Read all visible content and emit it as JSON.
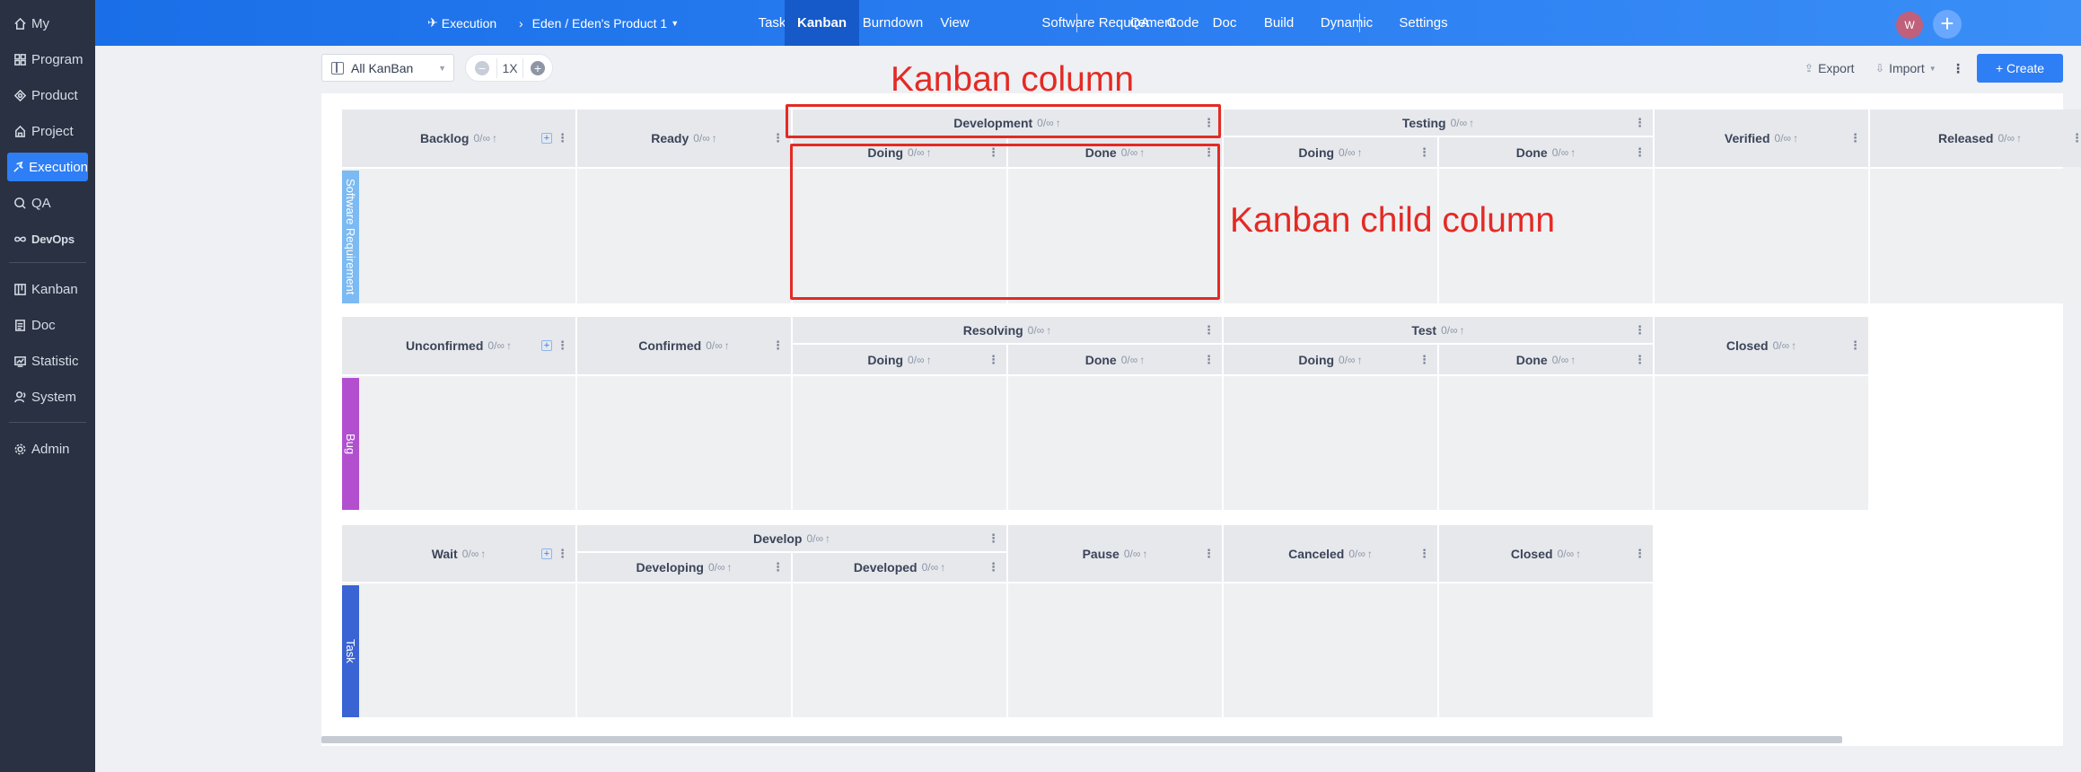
{
  "sidebar": {
    "items": [
      {
        "label": "My",
        "icon": "home-icon"
      },
      {
        "label": "Program",
        "icon": "grid-icon"
      },
      {
        "label": "Product",
        "icon": "product-icon"
      },
      {
        "label": "Project",
        "icon": "project-icon"
      },
      {
        "label": "Execution",
        "icon": "run-icon",
        "active": true
      },
      {
        "label": "QA",
        "icon": "qa-icon"
      },
      {
        "label": "DevOps",
        "icon": "infinity-icon"
      },
      {
        "label": "Kanban",
        "icon": "kanban-icon"
      },
      {
        "label": "Doc",
        "icon": "doc-icon"
      },
      {
        "label": "Statistic",
        "icon": "statistic-icon"
      },
      {
        "label": "System",
        "icon": "users-icon"
      },
      {
        "label": "Admin",
        "icon": "gear-icon"
      }
    ]
  },
  "topbar": {
    "module": "Execution",
    "breadcrumb": "Eden / Eden's Product 1",
    "nav": [
      "Task",
      "Kanban",
      "Burndown",
      "View",
      "Software Requirement",
      "QA",
      "Code",
      "Doc",
      "Build",
      "Dynamic",
      "Settings"
    ],
    "active_nav": "Kanban",
    "avatar": "W",
    "plus": "+"
  },
  "toolbar": {
    "kanban_select": "All KanBan",
    "zoom": "1X",
    "zoom_minus": "−",
    "zoom_plus": "+",
    "export": "Export",
    "import": "Import",
    "more": "⋮",
    "create": "+ Create"
  },
  "board": {
    "wip": "0/∞",
    "more": "⋮",
    "groups": [
      {
        "lane": "Software Requirement",
        "color": "#7bbaf2",
        "columns": [
          {
            "name": "Backlog"
          },
          {
            "name": "Ready"
          },
          {
            "name": "Development",
            "children": [
              "Doing",
              "Done"
            ]
          },
          {
            "name": "Testing",
            "children": [
              "Doing",
              "Done"
            ]
          },
          {
            "name": "Verified"
          },
          {
            "name": "Released"
          }
        ]
      },
      {
        "lane": "Bug",
        "color": "#b24fcf",
        "columns": [
          {
            "name": "Unconfirmed"
          },
          {
            "name": "Confirmed"
          },
          {
            "name": "Resolving",
            "children": [
              "Doing",
              "Done"
            ]
          },
          {
            "name": "Test",
            "children": [
              "Doing",
              "Done"
            ]
          },
          {
            "name": "Closed"
          }
        ]
      },
      {
        "lane": "Task",
        "color": "#3a63d4",
        "columns": [
          {
            "name": "Wait"
          },
          {
            "name": "Develop",
            "children": [
              "Developing",
              "Developed"
            ]
          },
          {
            "name": "Pause"
          },
          {
            "name": "Canceled"
          },
          {
            "name": "Closed"
          }
        ]
      }
    ]
  },
  "annotations": {
    "column": "Kanban column",
    "child_column": "Kanban child column"
  }
}
